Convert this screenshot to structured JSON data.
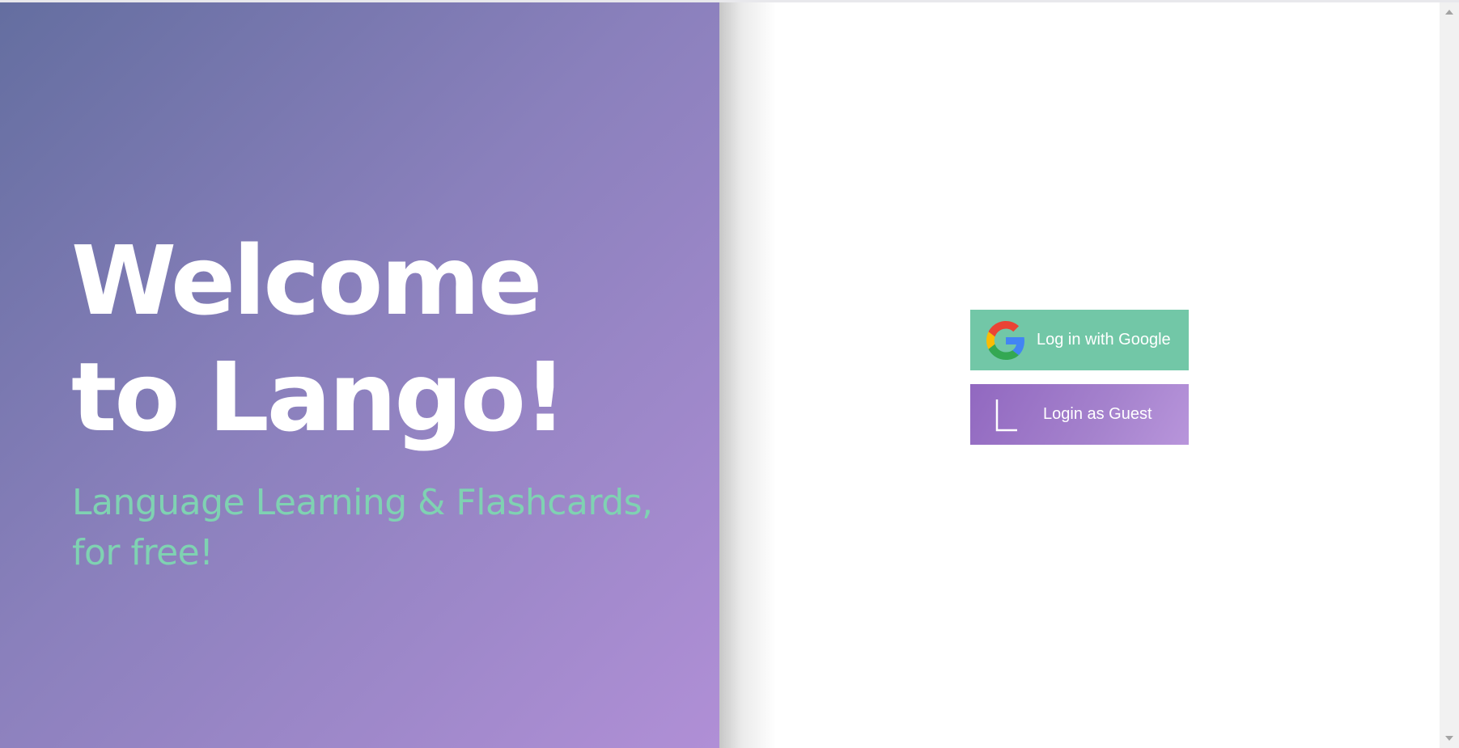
{
  "hero": {
    "title_line1": "Welcome",
    "title_line2": "to Lango!",
    "subtitle": "Language Learning & Flashcards, for free!",
    "gradient_start": "#646ea0",
    "gradient_end": "#b08fd6",
    "subtitle_color": "#7fd2b2"
  },
  "login": {
    "google_label": "Log in with Google",
    "google_icon": "google-g-logo",
    "google_color": "#72c7a7",
    "guest_label": "Login as Guest",
    "guest_icon": "letter-l-logo",
    "guest_color": "#9f7bcb"
  }
}
